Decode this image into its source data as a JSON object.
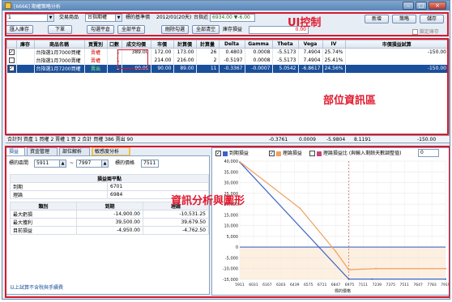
{
  "app": {
    "title": "[6666] 期權策略分析"
  },
  "toolbar": {
    "strategy_value": "1",
    "product_label": "交易商品",
    "product_value": "台指期權",
    "month_label": "標的基準價",
    "month_value": "2012/01(20天)",
    "underlying_label": "台指近",
    "underlying_value": "6934.00 ▼-6.00",
    "buttons": [
      "匯入庫存",
      "下單",
      "勾選平倉",
      "全部平倉",
      "刪除勾選",
      "全部清空"
    ],
    "pnl_label": "庫存損益",
    "pnl_value": "0.00",
    "right_buttons": [
      "新增",
      "策略",
      "儲存"
    ],
    "lock_label": "鎖定庫存"
  },
  "annotations": {
    "ui_control": "UI控制",
    "position_info": "部位資訊區",
    "analysis": "資訊分析與圖形"
  },
  "grid": {
    "headers": [
      "",
      "庫存",
      "商品名稱",
      "買賣別",
      "口數",
      "成交均價",
      "市價",
      "計算價",
      "計算量",
      "Delta",
      "Gamma",
      "Theta",
      "Vega",
      "IV",
      "市價損益試算"
    ],
    "rows": [
      {
        "checked": "✓",
        "stock": "",
        "name": "台指選1月7000買權",
        "side": "賣權",
        "side_type": "buy",
        "qty": "1",
        "avg": "389.00",
        "mkt": "172.00",
        "calc": "173.00",
        "vol": "26",
        "delta": "0.4803",
        "gamma": "0.0008",
        "theta": "-5.5173",
        "vega": "7.4904",
        "iv": "25.74%",
        "pnl": "-150.00"
      },
      {
        "checked": "",
        "stock": "",
        "name": "台指選1月7000賣權",
        "side": "賣權",
        "side_type": "buy",
        "qty": "1",
        "avg": "",
        "mkt": "214.00",
        "calc": "216.00",
        "vol": "2",
        "delta": "-0.5197",
        "gamma": "0.0008",
        "theta": "-5.5173",
        "vega": "7.4904",
        "iv": "25.41%",
        "pnl": ""
      },
      {
        "checked": "✓",
        "stock": "",
        "name": "台指選1月7200買權",
        "side": "賣出",
        "side_type": "sell",
        "qty": "1",
        "avg": "90.00",
        "mkt": "90.00",
        "calc": "89.00",
        "vol": "11",
        "delta": "-0.3367",
        "gamma": "-0.0007",
        "theta": "5.0542",
        "vega": "-6.8617",
        "iv": "24.56%",
        "pnl": "-150.00"
      }
    ]
  },
  "summary": {
    "text": "合計列 資產 1 買權 2 賣權 1 買 2 合計 買權 386 賣出 90",
    "delta": "-0.3761",
    "gamma": "0.0009",
    "theta": "-5.9804",
    "vega": "8.1191",
    "pnl": "-150.00"
  },
  "tabs": [
    "損益",
    "資金管理",
    "部位解析",
    "敏感度分析"
  ],
  "left_panel": {
    "range_label": "標的區間",
    "range_from": "5911",
    "range_to": "7997",
    "price_label": "標的價格",
    "price_value": "7511",
    "t1_header": "損益兩平點",
    "t1_rows": [
      {
        "k": "到期",
        "v": "6701"
      },
      {
        "k": "理論",
        "v": "6984"
      }
    ],
    "t2_headers": [
      "類別",
      "到期",
      "理論"
    ],
    "t2_rows": [
      {
        "k": "最大虧損",
        "a": "-14,900.00",
        "b": "-10,531.25"
      },
      {
        "k": "最大獲利",
        "a": "39,500.00",
        "b": "39,679.50"
      },
      {
        "k": "目前損益",
        "a": "-4,950.00",
        "b": "-4,762.50"
      }
    ],
    "footer": "以上試算不含稅與手續費"
  },
  "chart_panel": {
    "legend": [
      "到期損益",
      "理論損益",
      "理論損益比 (與輸入剩餘天數調整值)"
    ],
    "days_value": "0",
    "colors": {
      "expiry": "#3a63c9",
      "theory": "#f0a060",
      "hline": "#2a5ac8",
      "bg": "#fdf0e0"
    }
  },
  "chart_data": {
    "type": "line",
    "xlabel": "標的價格",
    "ylabel": "",
    "x_ticks": [
      "5911",
      "6031",
      "6167",
      "6303",
      "6439",
      "6575",
      "6711",
      "6847",
      "6975",
      "7111",
      "7239",
      "7375",
      "7511",
      "7647",
      "7783",
      "7919"
    ],
    "y_ticks": [
      "40,000",
      "35,000",
      "30,000",
      "25,000",
      "20,000",
      "15,000",
      "10,000",
      "5,000",
      "0",
      "-5,000",
      "-10,000",
      "-15,000"
    ],
    "ylim": [
      -15000,
      40000
    ],
    "xlim": [
      5911,
      7919
    ],
    "series": [
      {
        "name": "到期損益",
        "x": [
          5911,
          6975,
          7200,
          7919
        ],
        "y": [
          39500,
          -14900,
          -14900,
          -14900
        ]
      },
      {
        "name": "理論損益",
        "x": [
          5911,
          6500,
          6847,
          6975,
          7239,
          7919
        ],
        "y": [
          39679,
          18000,
          -2000,
          -10531,
          -10000,
          -10000
        ]
      }
    ],
    "grid": true
  }
}
